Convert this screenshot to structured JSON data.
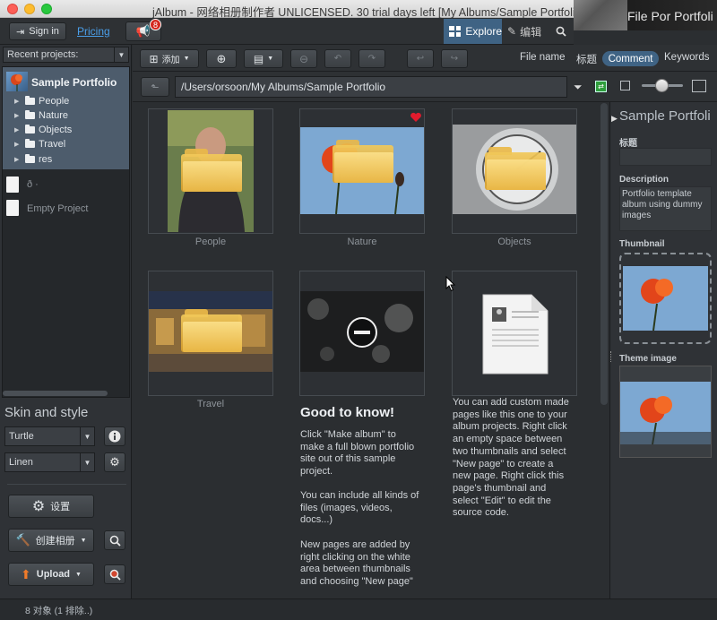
{
  "window": {
    "title": "jAlbum - 网络相册制作者 UNLICENSED. 30 trial days left [My Albums/Sample Portfolio]",
    "header_art_text": "File Por Portfoli"
  },
  "topbar": {
    "signin_label": "Sign in",
    "pricing_label": "Pricing",
    "news_badge": "8",
    "tab_explore": "Explore",
    "tab_edit": "编辑"
  },
  "left": {
    "projects_label": "Recent projects:",
    "project_name": "Sample Portfolio",
    "tree_items": [
      "People",
      "Nature",
      "Objects",
      "Travel",
      "res"
    ],
    "other_projects": [
      "ð  ·",
      "Empty Project"
    ],
    "skin_title": "Skin and style",
    "skin_value": "Turtle",
    "style_value": "Linen",
    "settings_label": "设置",
    "make_album_label": "创建相册",
    "upload_label": "Upload"
  },
  "toolbar": {
    "add_label": "添加",
    "fields": [
      "File name",
      "标题",
      "Comment",
      "Keywords"
    ],
    "active_field": "Comment"
  },
  "path": {
    "value": "/Users/orsoon/My Albums/Sample Portfolio"
  },
  "grid": {
    "items": [
      {
        "label": "People"
      },
      {
        "label": "Nature"
      },
      {
        "label": "Objects"
      },
      {
        "label": "Travel"
      }
    ],
    "good_title": "Good to know!",
    "paragraphs": [
      "Click \"Make album\" to make a full blown portfolio site out of this sample project.",
      "You can include all kinds of files (images, videos, docs...)",
      "New pages are added by right clicking on the white area between thumbnails and choosing \"New page\""
    ],
    "custom_page_text": "You can add custom made pages like this one to your album projects. Right click an empty space between two thumbnails and select \"New page\" to create a new page. Right click this page's thumbnail and select \"Edit\" to edit the source code."
  },
  "right": {
    "title": "Sample Portfoli",
    "title_label": "标题",
    "title_value": "",
    "description_label": "Description",
    "description_value": "Portfolio template album using dummy images",
    "thumbnail_label": "Thumbnail",
    "theme_label": "Theme image"
  },
  "status": {
    "text": "8 对象 (1 排除..)"
  },
  "colors": {
    "accent": "#3f6384",
    "link": "#4a9ee8",
    "badge": "#d4281f",
    "favorite": "#e21b2d"
  }
}
